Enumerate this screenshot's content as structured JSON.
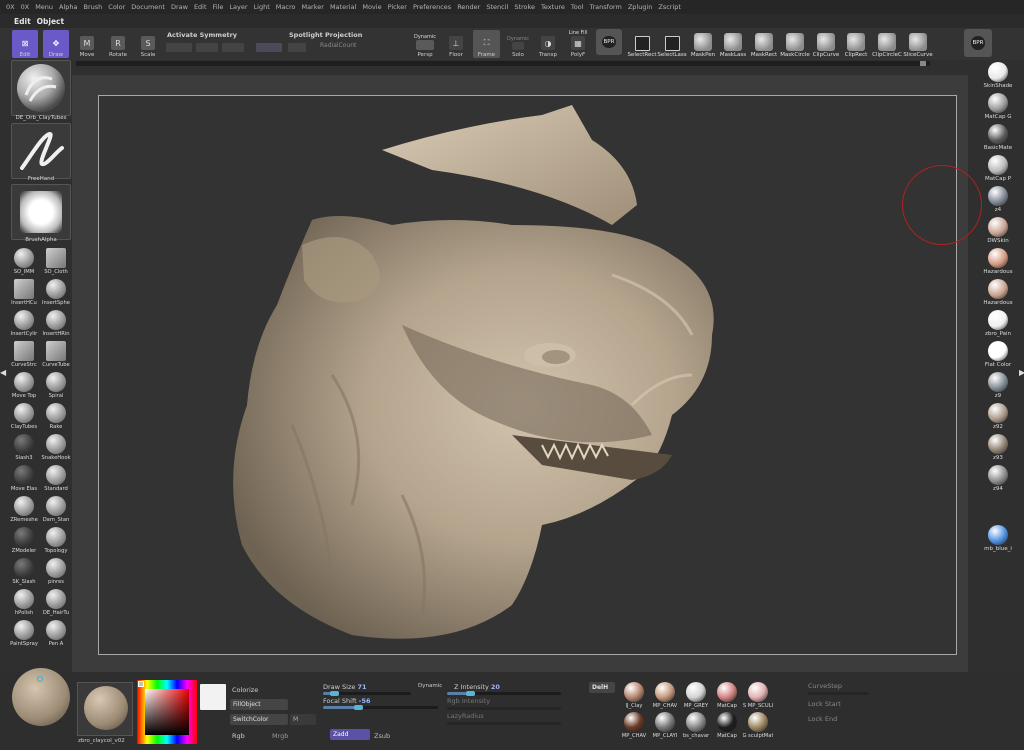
{
  "menu": [
    "0X",
    "0X",
    "Menu",
    "Alpha",
    "Brush",
    "Color",
    "Document",
    "Draw",
    "Edit",
    "File",
    "Layer",
    "Light",
    "Macro",
    "Marker",
    "Material",
    "Movie",
    "Picker",
    "Preferences",
    "Render",
    "Stencil",
    "Stroke",
    "Texture",
    "Tool",
    "Transform",
    "Zplugin",
    "Zscript"
  ],
  "subbar": [
    "Edit",
    "Object"
  ],
  "toolbar": {
    "edit": "Edit",
    "draw": "Draw",
    "move": "Move",
    "rotate": "Rotate",
    "scale": "Scale",
    "activate_symmetry": "Activate Symmetry",
    "spotlight_projection": "Spotlight Projection",
    "radial_count": "RadialCount",
    "dynamic": "Dynamic",
    "persp": "Persp",
    "floor": "Floor",
    "frame": "Frame",
    "solo_dynamic": "Dynamic",
    "solo": "Solo",
    "transp": "Transp",
    "line_fill": "Line Fill",
    "polyf": "PolyF",
    "brightness_badge": "BPR",
    "selectrect": "SelectRect",
    "selectlasso": "SelectLass",
    "maskpen": "MaskPen",
    "masklasso": "MaskLass",
    "maskrect": "MaskRect",
    "maskcircle": "MaskCircle",
    "clipcurve": "ClipCurve",
    "cliprect": "ClipRect",
    "clipcircle": "ClipCircleC",
    "slicecurve": "SliceCurve",
    "bpr_right": "BPR"
  },
  "left_shelf": {
    "brush_name": "DE_Orb_ClayTubes",
    "stroke_name": "FreeHand",
    "alpha_name": "BrushAlpha",
    "brushes": [
      [
        "SO_IMM",
        "SO_Cloth"
      ],
      [
        "InsertHCu",
        "InsertSphe"
      ],
      [
        "InsertCylir",
        "InsertHRin"
      ],
      [
        "CurveStrc",
        "CurveTube"
      ],
      [
        "Move Top",
        "Spiral"
      ],
      [
        "ClayTubes",
        "Rake"
      ],
      [
        "Slash3",
        "SnakeHook"
      ],
      [
        "Move Elas",
        "Standard"
      ],
      [
        "ZRemeshe",
        "Dam_Stan"
      ],
      [
        "ZModeler",
        "Topology"
      ],
      [
        "SK_Slash",
        "pinres"
      ],
      [
        "hPolish",
        "DE_HairTu"
      ],
      [
        "PaintSpray",
        "Pen A"
      ]
    ]
  },
  "right_shelf": [
    {
      "name": "SkinShade",
      "color": "#e9e9e9"
    },
    {
      "name": "MatCap G",
      "color": "#9a9a9a"
    },
    {
      "name": "BasicMate",
      "color": "#5a5a5a"
    },
    {
      "name": "MatCap P",
      "color": "#b8b8b8"
    },
    {
      "name": "z4",
      "color": "#7f8593"
    },
    {
      "name": "DWSkin",
      "color": "#c7a293"
    },
    {
      "name": "Hazardous",
      "color": "#d39880"
    },
    {
      "name": "Hazardous",
      "color": "#c9a28c"
    },
    {
      "name": "zbro_Pain",
      "color": "#f0f0f0"
    },
    {
      "name": "Flat Color",
      "color": "#ffffff"
    },
    {
      "name": "z9",
      "color": "#7e8a93"
    },
    {
      "name": "z92",
      "color": "#a89886"
    },
    {
      "name": "z93",
      "color": "#8f8070"
    },
    {
      "name": "z94",
      "color": "#8a8a8a"
    },
    {
      "name": "mb_blue_i",
      "color": "#4a8ee0"
    }
  ],
  "bottom": {
    "material_name": "zbro_claycol_v02",
    "colorize": "Colorize",
    "fillobject": "FillObject",
    "switchcolor": "SwitchColor",
    "m": "M",
    "rgb": "Rgb",
    "mrgb": "Mrgb",
    "zadd": "Zadd",
    "zsub": "Zsub",
    "draw_size_label": "Draw Size",
    "draw_size_value": "71",
    "dynamic": "Dynamic",
    "focal_shift_label": "Focal Shift",
    "focal_shift_value": "-56",
    "z_intensity_label": "Z Intensity",
    "z_intensity_value": "20",
    "rgb_intensity": "Rgb Intensity",
    "lazymouse": "LazyRadius",
    "delh": "DelH",
    "curvestep": "CurveStep",
    "lock_start": "Lock Start",
    "lock_end": "Lock End",
    "draw_size_fraction": 0.12,
    "focal_shift_fraction": 0.3,
    "z_intensity_fraction": 0.2,
    "materials_row1": [
      {
        "name": "IJ_Clay",
        "color": "#b98770"
      },
      {
        "name": "MP_CHAV",
        "color": "#c49a7c"
      },
      {
        "name": "MP_GREY",
        "color": "#d4d4d4"
      },
      {
        "name": "MatCap",
        "color": "#d48484"
      },
      {
        "name": "S MP_SCULI",
        "color": "#e2b2b2"
      }
    ],
    "materials_row2": [
      {
        "name": "MP_CHAV",
        "color": "#6b3a24"
      },
      {
        "name": "MP_CLAYI",
        "color": "#7a7a7a"
      },
      {
        "name": "bs_chavar",
        "color": "#8a8a8a"
      },
      {
        "name": "MatCap",
        "color": "#1e1e1e"
      },
      {
        "name": "G sculptMat",
        "color": "#a08a63"
      }
    ]
  }
}
